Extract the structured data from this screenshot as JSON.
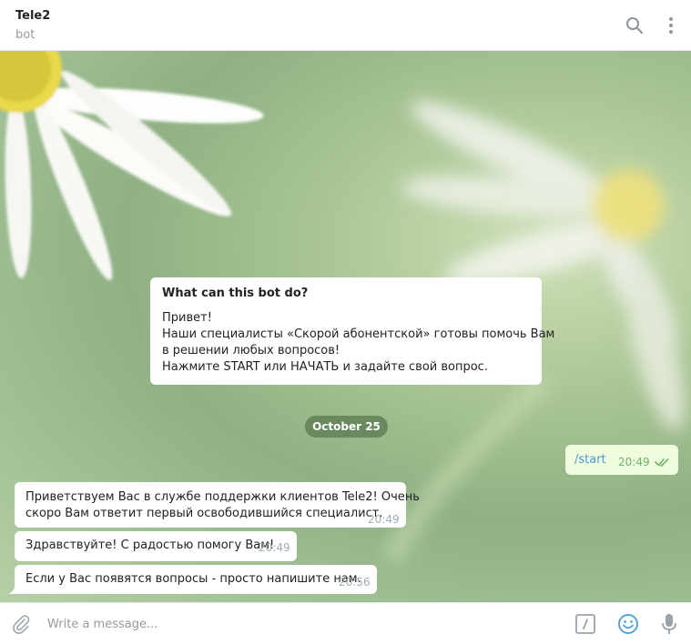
{
  "header": {
    "title": "Tele2",
    "subtitle": "bot",
    "icons": [
      "search-icon",
      "more-vertical-icon"
    ]
  },
  "bot_info": {
    "title": "What can this bot do?",
    "lines": [
      "Привет!",
      "Наши специалисты «Скорой абонентской» готовы помочь Вам",
      "в решении любых вопросов!",
      "Нажмите START или НАЧАТЬ и задайте свой вопрос."
    ]
  },
  "date_separator": "October 25",
  "messages": [
    {
      "direction": "out",
      "text": "/start",
      "time": "20:49",
      "status": "read"
    },
    {
      "direction": "in",
      "lines": [
        "Приветствуем Вас в службе поддержки клиентов Tele2! Очень",
        "скоро Вам ответит первый освободившийся специалист."
      ],
      "time": "20:49"
    },
    {
      "direction": "in",
      "text": "Здравствуйте! С радостью помогу Вам!",
      "time": "20:49"
    },
    {
      "direction": "in",
      "text": "Если у Вас появятся вопросы - просто напишите нам.",
      "time": "20:56"
    }
  ],
  "composer": {
    "placeholder": "Write a message...",
    "icons": [
      "attach-icon",
      "bot-commands-icon",
      "emoji-icon",
      "microphone-icon"
    ]
  },
  "colors": {
    "accent": "#56a4d8",
    "outgoing_bubble": "#effdde",
    "read_check": "#6db566",
    "date_pill": "#587a50"
  }
}
